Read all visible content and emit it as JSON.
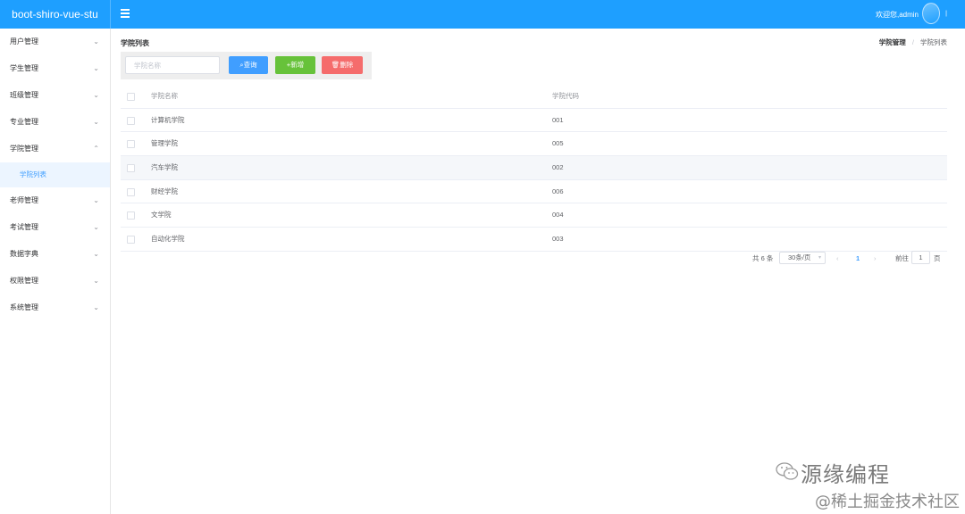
{
  "app": {
    "title": "boot-shiro-vue-stu",
    "welcome": "欢迎您,admin",
    "accent_color": "#1e9fff"
  },
  "sidebar": {
    "items": [
      {
        "label": "用户管理"
      },
      {
        "label": "学生管理"
      },
      {
        "label": "班级管理"
      },
      {
        "label": "专业管理"
      },
      {
        "label": "学院管理",
        "expanded": true,
        "children": [
          {
            "label": "学院列表",
            "active": true
          }
        ]
      },
      {
        "label": "老师管理"
      },
      {
        "label": "考试管理"
      },
      {
        "label": "数据字典"
      },
      {
        "label": "权限管理"
      },
      {
        "label": "系统管理"
      }
    ]
  },
  "page": {
    "title": "学院列表",
    "breadcrumb": [
      "学院管理",
      "学院列表"
    ]
  },
  "toolbar": {
    "search_placeholder": "学院名称",
    "search_value": "",
    "search_label": "查询",
    "add_label": "新增",
    "delete_label": "删除"
  },
  "table": {
    "columns": [
      "学院名称",
      "学院代码"
    ],
    "rows": [
      {
        "name": "计算机学院",
        "code": "001"
      },
      {
        "name": "管理学院",
        "code": "005"
      },
      {
        "name": "汽车学院",
        "code": "002"
      },
      {
        "name": "财经学院",
        "code": "006"
      },
      {
        "name": "文学院",
        "code": "004"
      },
      {
        "name": "自动化学院",
        "code": "003"
      }
    ]
  },
  "pagination": {
    "total_text": "共 6 条",
    "page_size": "30条/页",
    "current_page": "1",
    "goto_label": "前往",
    "goto_value": "1",
    "page_suffix": "页"
  },
  "watermark": {
    "line1": "源缘编程",
    "line2": "@稀土掘金技术社区"
  }
}
